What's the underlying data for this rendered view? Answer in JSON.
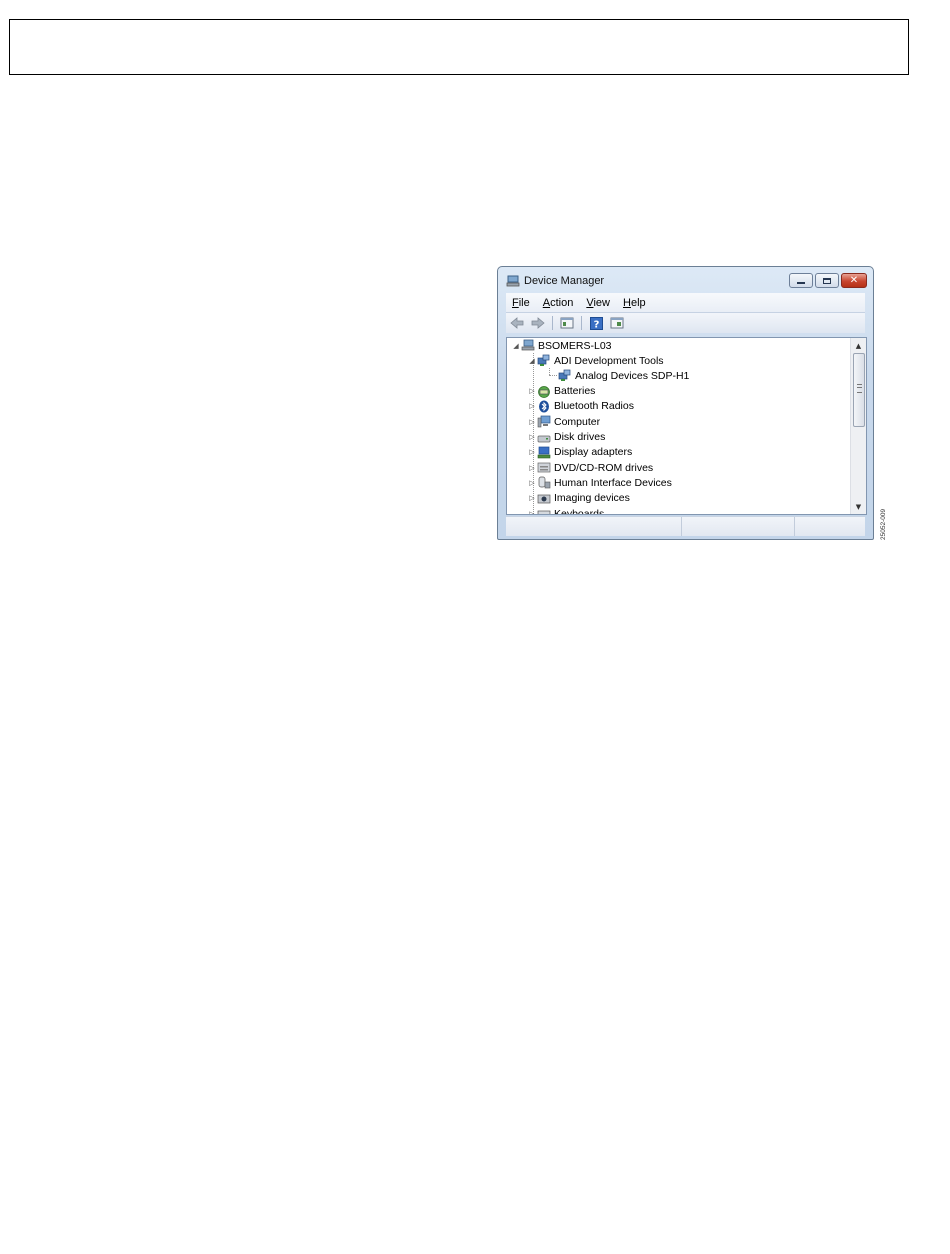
{
  "window": {
    "title": "Device Manager",
    "menu": [
      {
        "underline": "F",
        "rest": "ile"
      },
      {
        "underline": "A",
        "rest": "ction"
      },
      {
        "underline": "V",
        "rest": "iew"
      },
      {
        "underline": "H",
        "rest": "elp"
      }
    ],
    "caption_close_glyph": "✕"
  },
  "tree": {
    "root": "BSOMERS-L03",
    "nodes": [
      {
        "label": "ADI Development Tools",
        "expanded": true,
        "icon": "usb-device-icon"
      },
      {
        "label": "Analog Devices SDP-H1",
        "child": true,
        "icon": "usb-device-icon"
      },
      {
        "label": "Batteries",
        "icon": "battery-icon"
      },
      {
        "label": "Bluetooth Radios",
        "icon": "bluetooth-icon"
      },
      {
        "label": "Computer",
        "icon": "computer-icon"
      },
      {
        "label": "Disk drives",
        "icon": "disk-drive-icon"
      },
      {
        "label": "Display adapters",
        "icon": "display-adapter-icon"
      },
      {
        "label": "DVD/CD-ROM drives",
        "icon": "dvd-drive-icon"
      },
      {
        "label": "Human Interface Devices",
        "icon": "hid-icon"
      },
      {
        "label": "Imaging devices",
        "icon": "camera-icon"
      },
      {
        "label": "Keyboards",
        "icon": "keyboard-icon"
      }
    ]
  },
  "figure_id": "25052-009"
}
